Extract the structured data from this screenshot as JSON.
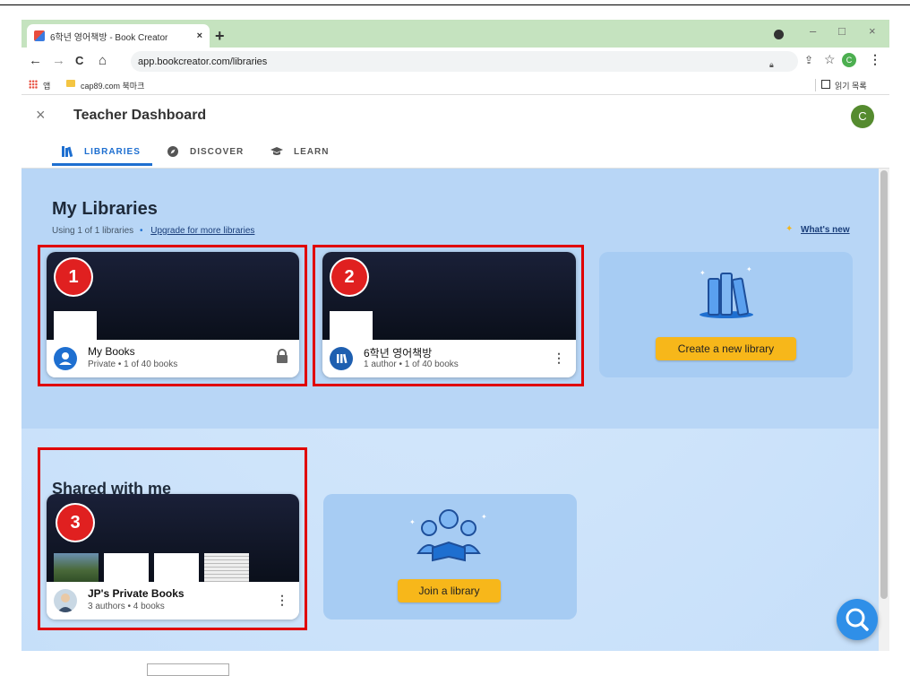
{
  "browser": {
    "tab_title": "6학년 영어책방 - Book Creator",
    "tab_close": "×",
    "new_tab": "+",
    "url": "app.bookcreator.com/libraries",
    "profile_initial": "C",
    "window_minimize": "–",
    "window_maximize": "□",
    "window_close": "×",
    "nav_back": "←",
    "nav_forward": "→",
    "nav_reload": "C",
    "nav_home": "⌂",
    "star": "☆",
    "menu_dots": "⋮",
    "bookmarks": {
      "apps_label": "앱",
      "item": "cap89.com 북마크",
      "reading_list": "읽기 목록"
    }
  },
  "header": {
    "close": "×",
    "title": "Teacher Dashboard",
    "avatar_initial": "C",
    "tabs": [
      {
        "label": "LIBRARIES",
        "active": true
      },
      {
        "label": "DISCOVER",
        "active": false
      },
      {
        "label": "LEARN",
        "active": false
      }
    ]
  },
  "my_libraries": {
    "heading": "My Libraries",
    "usage": "Using 1 of 1 libraries",
    "bullet": "•",
    "upgrade_link": "Upgrade for more libraries",
    "whats_new": "What's new",
    "cards": [
      {
        "badge": "1",
        "name": "My Books",
        "meta": "Private • 1 of 40 books",
        "icon": "person-icon",
        "action": "lock-icon"
      },
      {
        "badge": "2",
        "name": "6학년 영어책방",
        "meta": "1 author • 1 of 40 books",
        "icon": "library-icon",
        "action": "more-vert-icon"
      }
    ],
    "create_button": "Create a new library"
  },
  "shared": {
    "heading": "Shared with me",
    "card": {
      "badge": "3",
      "name": "JP's Private Books",
      "meta": "3 authors • 4 books"
    },
    "join_button": "Join a library"
  },
  "colors": {
    "accent": "#1e6fd0",
    "badge_red": "#e02020",
    "button_yellow": "#f7b71a",
    "content_bg": "#cde4fb"
  }
}
